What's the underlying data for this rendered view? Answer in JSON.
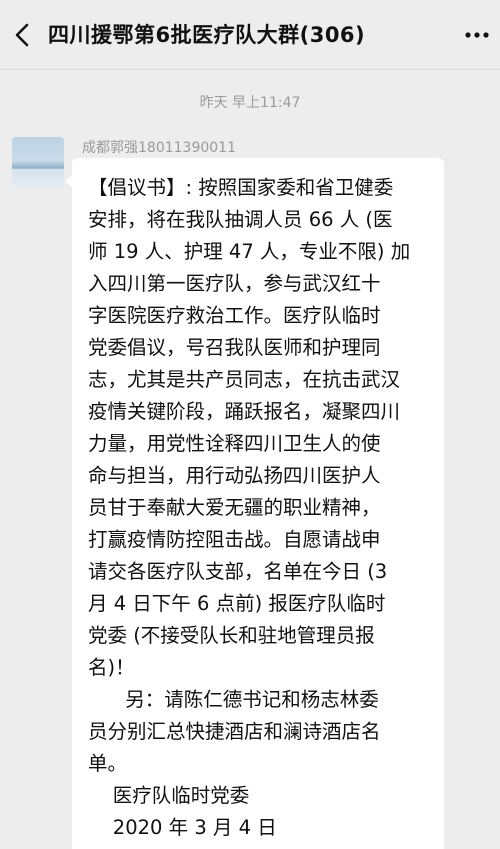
{
  "header": {
    "back_icon": "chevron-left-icon",
    "title": "四川援鄂第6批医疗队大群(306)",
    "more_icon": "more-dots-icon"
  },
  "time_divider": "昨天 早上11:47",
  "message": {
    "sender": "成都郭强18011390011",
    "avatar_icon": "sea-landscape-avatar",
    "text": "【倡议书】: 按照国家委和省卫健委\n安排，将在我队抽调人员 66 人 (医\n师 19 人、护理 47 人，专业不限) 加\n入四川第一医疗队，参与武汉红十\n字医院医疗救治工作。医疗队临时\n党委倡议，号召我队医师和护理同\n志，尤其是共产员同志，在抗击武汉\n疫情关键阶段，踊跃报名，凝聚四川\n力量，用党性诠释四川卫生人的使\n命与担当，用行动弘扬四川医护人\n员甘于奉献大爱无疆的职业精神，\n打赢疫情防控阻击战。自愿请战申\n请交各医疗队支部，名单在今日 (3\n月 4 日下午 6 点前) 报医疗队临时\n党委 (不接受队长和驻地管理员报\n名)！\n      另：请陈仁德书记和杨志林委\n员分别汇总快捷酒店和澜诗酒店名\n单。\n    医疗队临时党委\n    2020 年 3 月 4 日"
  },
  "colors": {
    "background": "#ededed",
    "bubble": "#ffffff",
    "meta_text": "#9a9a9a"
  }
}
